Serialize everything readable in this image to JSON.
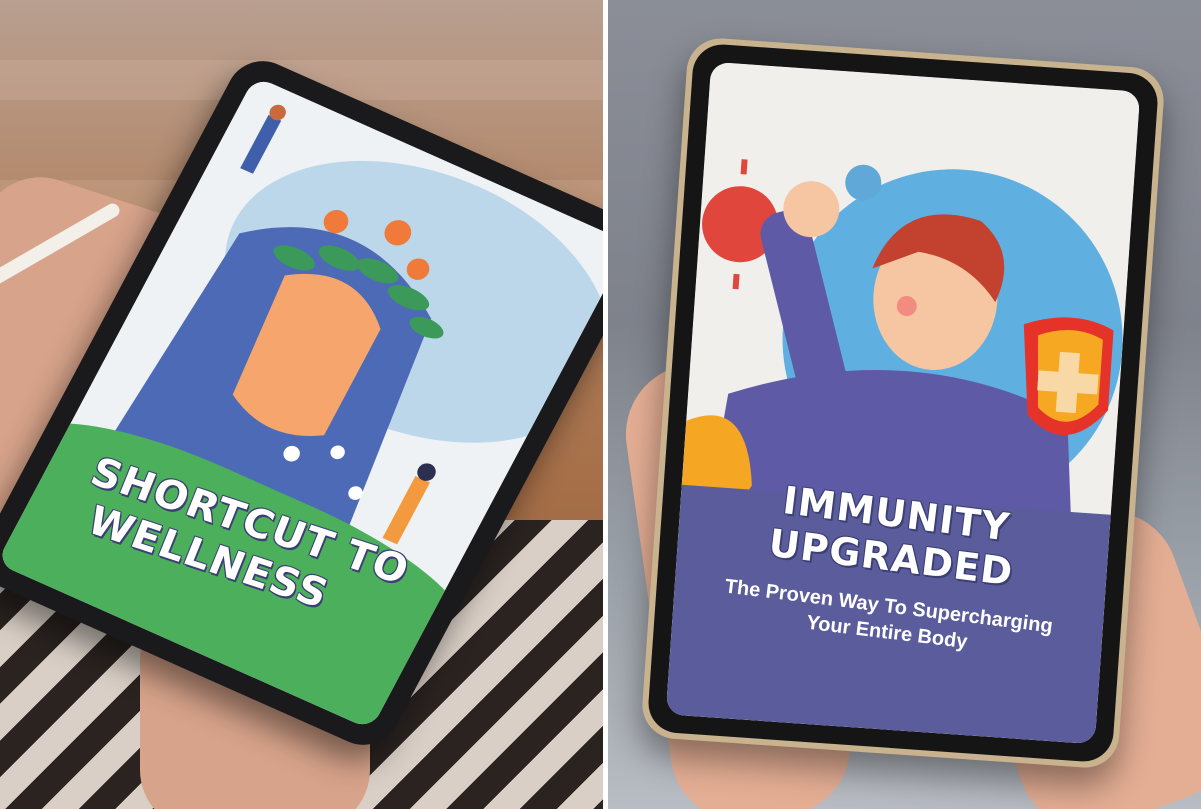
{
  "left_cover": {
    "title_line1": "SHORTCUT TO",
    "title_line2": "WELLNESS",
    "colors": {
      "band": "#4caf5c",
      "hair": "#4d6ab7",
      "skin": "#f6a66c",
      "shirt": "#f39a3f"
    }
  },
  "right_cover": {
    "title": "IMMUNITY UPGRADED",
    "subtitle_line1": "The Proven Way To Supercharging",
    "subtitle_line2": "Your Entire Body",
    "colors": {
      "band": "#5a5c9c",
      "sweater": "#5e5aa6",
      "hair": "#c2422f",
      "shield": "#e6332a",
      "virus": "#e0463c"
    }
  }
}
